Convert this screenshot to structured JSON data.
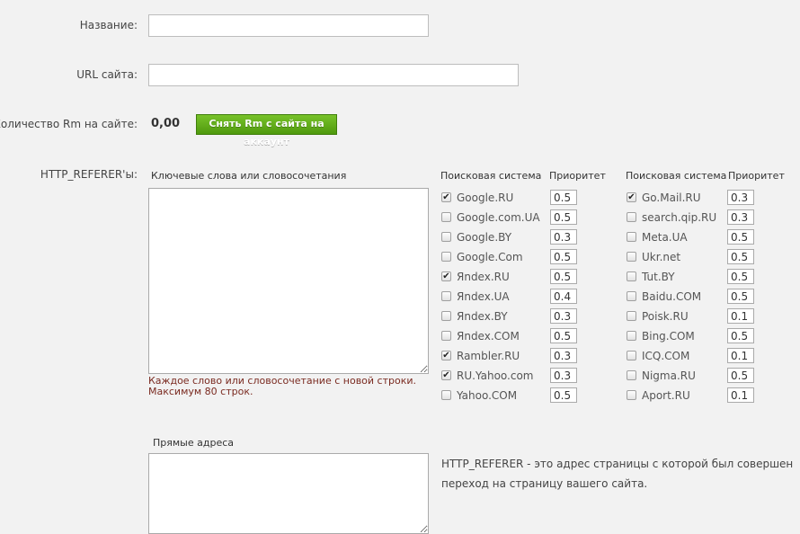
{
  "name_label": "Название:",
  "name_value": "",
  "url_label": "URL сайта:",
  "url_value": "",
  "rm": {
    "label": "Количество Rm на сайте:",
    "amount": "0,00",
    "button": "Снять Rm с сайта на аккаунт"
  },
  "referer": {
    "label": "HTTP_REFERER'ы:",
    "keywords_label": "Ключевые слова или словосочетания",
    "keywords_value": "",
    "hint_line1": "Каждое слово или словосочетание с новой строки.",
    "hint_line2": "Максимум 80 строк."
  },
  "engines_header": "Поисковая система",
  "priority_header": "Приоритет",
  "engines_left": [
    {
      "name": "Google.RU",
      "checked": true,
      "priority": "0.5"
    },
    {
      "name": "Google.com.UA",
      "checked": false,
      "priority": "0.5"
    },
    {
      "name": "Google.BY",
      "checked": false,
      "priority": "0.3"
    },
    {
      "name": "Google.Com",
      "checked": false,
      "priority": "0.5"
    },
    {
      "name": "Яndex.RU",
      "checked": true,
      "priority": "0.5"
    },
    {
      "name": "Яndex.UA",
      "checked": false,
      "priority": "0.4"
    },
    {
      "name": "Яndex.BY",
      "checked": false,
      "priority": "0.3"
    },
    {
      "name": "Яndex.COM",
      "checked": false,
      "priority": "0.5"
    },
    {
      "name": "Rambler.RU",
      "checked": true,
      "priority": "0.3"
    },
    {
      "name": "RU.Yahoo.com",
      "checked": true,
      "priority": "0.3"
    },
    {
      "name": "Yahoo.COM",
      "checked": false,
      "priority": "0.5"
    }
  ],
  "engines_right": [
    {
      "name": "Go.Mail.RU",
      "checked": true,
      "priority": "0.3"
    },
    {
      "name": "search.qip.RU",
      "checked": false,
      "priority": "0.3"
    },
    {
      "name": "Meta.UA",
      "checked": false,
      "priority": "0.5"
    },
    {
      "name": "Ukr.net",
      "checked": false,
      "priority": "0.5"
    },
    {
      "name": "Tut.BY",
      "checked": false,
      "priority": "0.5"
    },
    {
      "name": "Baidu.COM",
      "checked": false,
      "priority": "0.5"
    },
    {
      "name": "Poisk.RU",
      "checked": false,
      "priority": "0.1"
    },
    {
      "name": "Bing.COM",
      "checked": false,
      "priority": "0.5"
    },
    {
      "name": "ICQ.COM",
      "checked": false,
      "priority": "0.1"
    },
    {
      "name": "Nigma.RU",
      "checked": false,
      "priority": "0.5"
    },
    {
      "name": "Aport.RU",
      "checked": false,
      "priority": "0.1"
    }
  ],
  "direct": {
    "label": "Прямые адреса",
    "value": "",
    "desc_line1": "HTTP_REFERER - это адрес страницы с которой был совершен",
    "desc_line2": "переход на страницу вашего сайта."
  }
}
